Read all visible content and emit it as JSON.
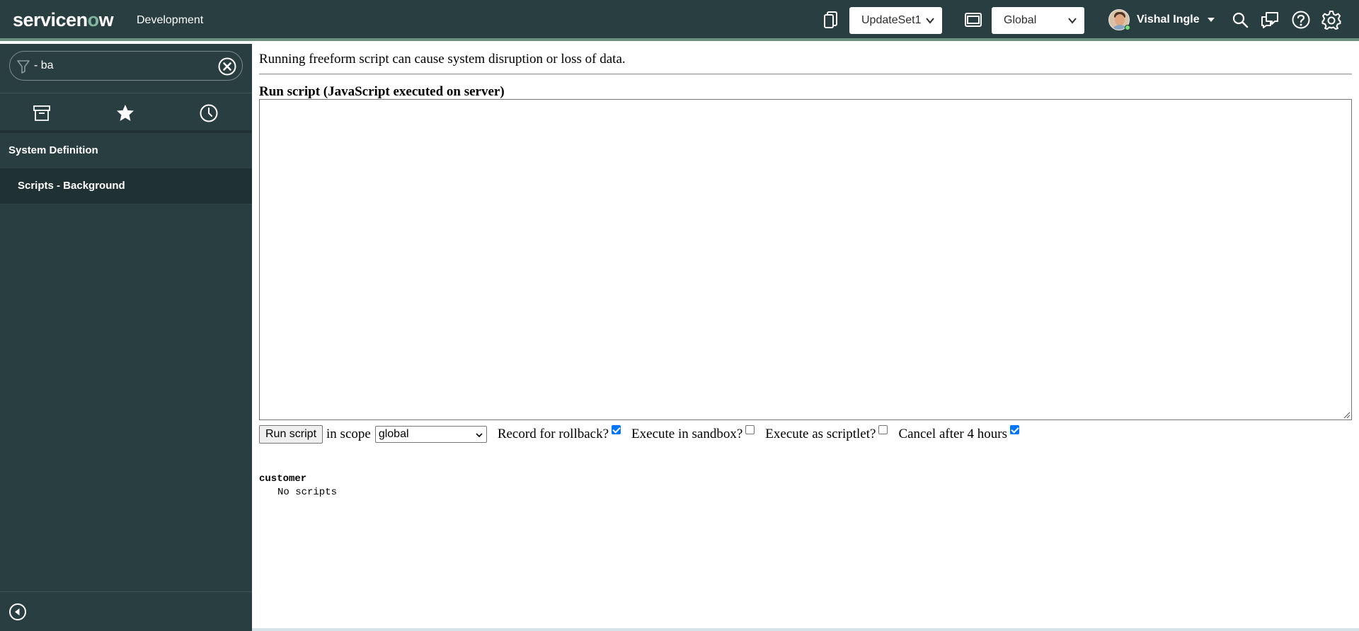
{
  "header": {
    "logo_text_pre": "servicen",
    "logo_text_o": "o",
    "logo_text_post": "w",
    "instance_name": "Development",
    "update_set": "UpdateSet1",
    "application_scope": "Global",
    "user_name": "Vishal Ingle",
    "icons": [
      "update-set-icon",
      "application-icon",
      "search-icon",
      "connect-chat-icon",
      "help-icon",
      "settings-icon"
    ],
    "brand_color": "#293e40",
    "accent_color": "#81b5a1"
  },
  "sidebar": {
    "filter_value": "- ba",
    "tabs": [
      "all-applications-icon",
      "favorites-icon",
      "history-icon"
    ],
    "section_title": "System Definition",
    "module_label": "Scripts - Background"
  },
  "main": {
    "warning_text": "Running freeform script can cause system disruption or loss of data.",
    "run_script_label": "Run script (JavaScript executed on server)",
    "script_value": "",
    "run_button_label": "Run script",
    "in_scope_label": "in scope",
    "scope_value": "global",
    "options": [
      {
        "label": "Record for rollback?",
        "checked": true
      },
      {
        "label": "Execute in sandbox?",
        "checked": false
      },
      {
        "label": "Execute as scriptlet?",
        "checked": false
      },
      {
        "label": "Cancel after 4 hours",
        "checked": true
      }
    ],
    "scope_list_title": "customer",
    "scope_list_entry": "No scripts",
    "checkbox_color": "#0075ff"
  }
}
